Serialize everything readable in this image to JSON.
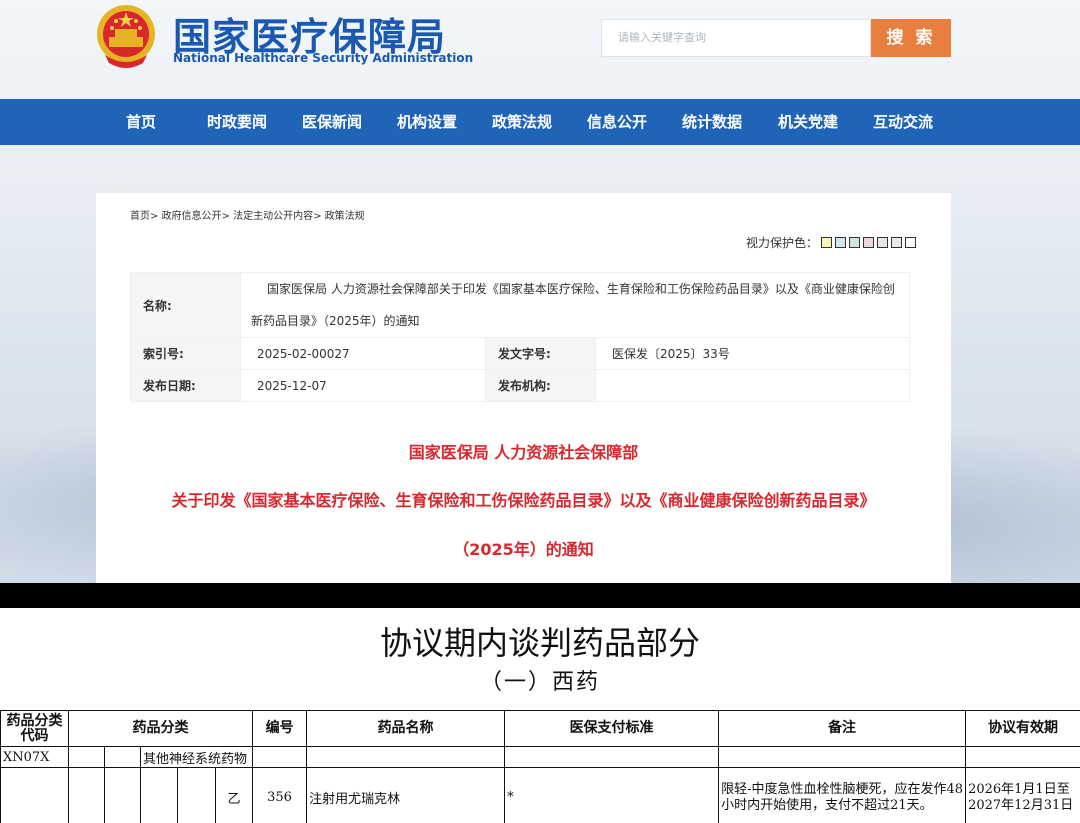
{
  "site": {
    "title_cn": "国家医疗保障局",
    "title_en": "National Healthcare Security Administration",
    "search_placeholder": "请输入关键字查询",
    "search_button": "搜 索"
  },
  "nav": [
    "首页",
    "时政要闻",
    "医保新闻",
    "机构设置",
    "政策法规",
    "信息公开",
    "统计数据",
    "机关党建",
    "互动交流"
  ],
  "breadcrumb": "首页> 政府信息公开> 法定主动公开内容> 政策法规",
  "vision": {
    "label": "视力保护色：",
    "colors": [
      "#fbf6b6",
      "#cfe8f0",
      "#c9e7dc",
      "#f1d3de",
      "#e6e6e6",
      "#e8e8ee",
      "#ffffff"
    ]
  },
  "meta": {
    "name_label": "名称:",
    "name_value": "国家医保局 人力资源社会保障部关于印发《国家基本医疗保险、生育保险和工伤保险药品目录》以及《商业健康保险创新药品目录》（2025年）的通知",
    "index_label": "索引号:",
    "index_value": "2025-02-00027",
    "docno_label": "发文字号:",
    "docno_value": "医保发〔2025〕33号",
    "date_label": "发布日期:",
    "date_value": "2025-12-07",
    "org_label": "发布机构:",
    "org_value": ""
  },
  "headline": {
    "line1": "国家医保局 人力资源社会保障部",
    "line2": "关于印发《国家基本医疗保险、生育保险和工伤保险药品目录》以及《商业健康保险创新药品目录》",
    "line3": "（2025年）的通知"
  },
  "doc": {
    "title": "协议期内谈判药品部分",
    "subtitle": "（一）西药",
    "headers": {
      "code": "药品分类代码",
      "category": "药品分类",
      "number": "编号",
      "name": "药品名称",
      "standard": "医保支付标准",
      "remarks": "备注",
      "validity": "协议有效期"
    },
    "row1": {
      "code": "XN07X",
      "category": "其他神经系统药物"
    },
    "row2": {
      "grade": "乙",
      "number": "356",
      "name": "注射用尤瑞克林",
      "standard": "*",
      "remarks": "限轻-中度急性血栓性脑梗死，应在发作48小时内开始使用，支付不超过21天。",
      "validity": "2026年1月1日至2027年12月31日"
    }
  }
}
